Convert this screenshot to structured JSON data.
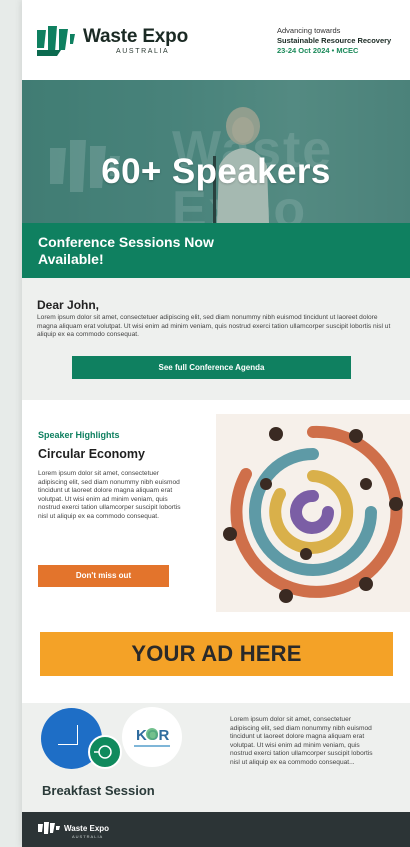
{
  "header": {
    "logo_text": "Waste Expo",
    "logo_sub": "AUSTRALIA",
    "tagline_line1": "Advancing towards",
    "tagline_line2": "Sustainable Resource Recovery",
    "tagline_date": "23-24 Oct 2024 • MCEC"
  },
  "hero": {
    "title": "60+ Speakers",
    "watermark": "Waste Expo"
  },
  "band": {
    "title": "Conference Sessions Now Available!"
  },
  "intro": {
    "greeting": "Dear John,",
    "body": "Lorem ipsum dolor sit amet, consectetuer adipiscing elit, sed diam nonummy nibh euismod tincidunt ut laoreet dolore magna aliquam erat volutpat. Ut wisi enim ad minim veniam, quis nostrud exerci tation ullamcorper suscipit lobortis nisl ut aliquip ex ea commodo consequat.",
    "button": "See full Conference Agenda"
  },
  "speaker": {
    "kicker": "Speaker Highlights",
    "title": "Circular Economy",
    "body": "Lorem ipsum dolor sit amet, consectetuer adipiscing elit, sed diam nonummy nibh euismod tincidunt ut laoreet dolore magna aliquam erat volutpat. Ut wisi enim ad minim veniam, quis nostrud exerci tation ullamcorper suscipit lobortis nisl ut aliquip ex ea commodo consequat.",
    "button": "Don't miss out"
  },
  "ad": {
    "text": "YOUR AD HERE"
  },
  "breakfast": {
    "title": "Breakfast Session",
    "logo": "KOR",
    "body": "Lorem ipsum dolor sit amet, consectetuer adipiscing elit, sed diam nonummy nibh euismod tincidunt ut laoreet dolore magna aliquam erat volutpat. Ut wisi enim ad minim veniam, quis nostrud exerci tation ullamcorper suscipit lobortis nisl ut aliquip ex ea commodo consequat..."
  },
  "footer": {
    "logo_text": "Waste Expo",
    "logo_sub": "AUSTRALIA"
  },
  "colors": {
    "brand_green": "#0f8060",
    "orange": "#e3742c",
    "ad_yellow": "#f4a227",
    "footer_dark": "#2c3436"
  }
}
